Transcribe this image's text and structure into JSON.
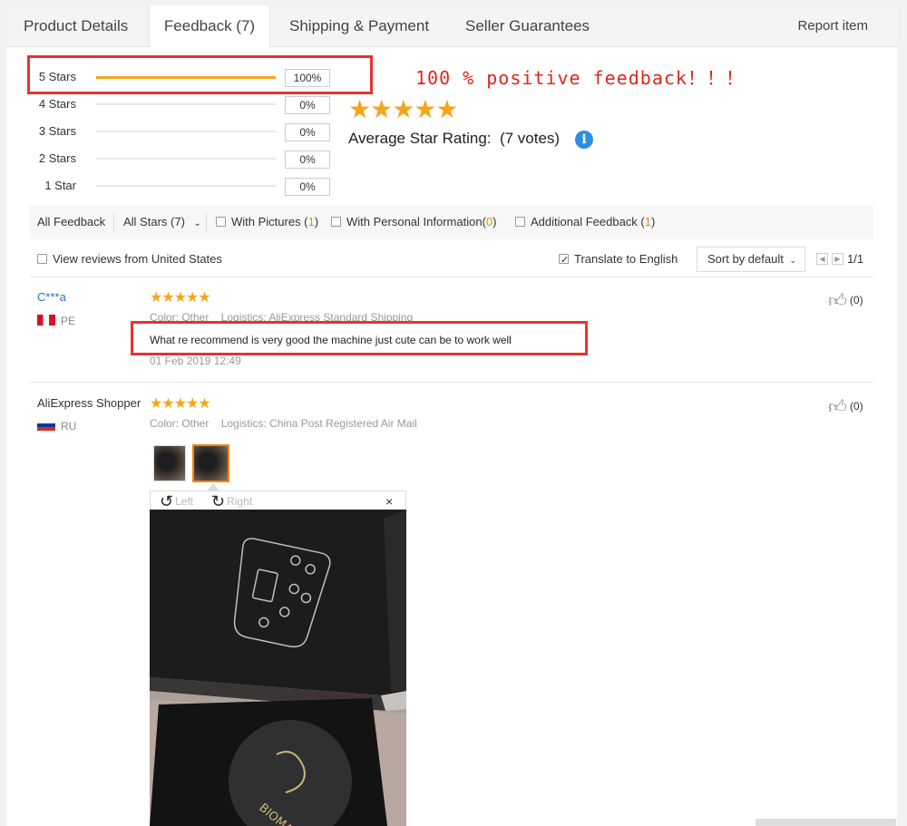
{
  "tabs": [
    {
      "label": "Product Details"
    },
    {
      "label": "Feedback (7)"
    },
    {
      "label": "Shipping & Payment"
    },
    {
      "label": "Seller Guarantees"
    }
  ],
  "report_label": "Report item",
  "ratings": [
    {
      "label": "5 Stars",
      "percent_label": "100%",
      "fill": 1.0
    },
    {
      "label": "4 Stars",
      "percent_label": "0%",
      "fill": 0
    },
    {
      "label": "3 Stars",
      "percent_label": "0%",
      "fill": 0
    },
    {
      "label": "2 Stars",
      "percent_label": "0%",
      "fill": 0
    },
    {
      "label": "1 Star",
      "percent_label": "0%",
      "fill": 0
    }
  ],
  "annotation_text": "100 % positive feedback！！！",
  "average": {
    "stars": "★★★★★",
    "label": "Average Star Rating:",
    "votes": "(7 votes)",
    "info_icon": "i"
  },
  "filters": {
    "all_feedback": "All Feedback",
    "all_stars": "All Stars (7)",
    "with_pictures": "With Pictures (",
    "with_pictures_count": "1",
    "with_personal": "With Personal Information(",
    "with_personal_count": "0",
    "additional": "Additional Feedback (",
    "additional_count": "1",
    "close_paren": ")"
  },
  "view_reviews_label": "View reviews from United States",
  "translate_label": "Translate to English",
  "sort_label": "Sort by default",
  "page_indicator": "1/1",
  "reviews": [
    {
      "user": "C***a",
      "country": "PE",
      "stars": "★★★★★",
      "meta": "Color: Other    Logistics: AliExpress Standard Shipping",
      "text": "What re recommend is very good the machine just cute can be to work well",
      "date": "01 Feb 2019 12:49",
      "likes": "(0)"
    },
    {
      "user": "AliExpress Shopper",
      "country": "RU",
      "stars": "★★★★★",
      "meta": "Color: Other    Logistics: China Post Registered Air Mail",
      "likes": "(0)"
    }
  ],
  "viewer": {
    "left_label": "Left",
    "right_label": "Right",
    "close": "×"
  },
  "photo_brand": "BIOMASER",
  "colors": {
    "accent": "#f4a61a",
    "highlight_red": "#e8322f",
    "link_blue": "#2a6fc4",
    "orange": "#f08a00"
  }
}
